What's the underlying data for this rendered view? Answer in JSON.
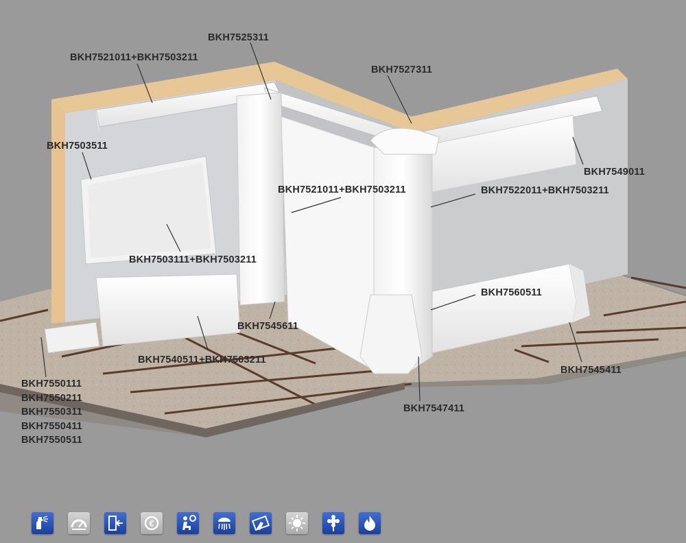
{
  "labels": {
    "l1": "BKH7525311",
    "l2": "BKH7521011+BKH7503211",
    "l3": "BKH7527311",
    "l4": "BKH7503511",
    "l5": "BKH7549011",
    "l6": "BKH7521011+BKH7503211",
    "l7": "BKH7522011+BKH7503211",
    "l8": "BKH7503111+BKH7503211",
    "l9": "BKH7560511",
    "l10": "BKH7545611",
    "l11": "BKH7540511+BKH7503211",
    "l12": "BKH7545411",
    "l13": "BKH7547411",
    "stack": [
      "BKH7550111",
      "BKH7550211",
      "BKH7550311",
      "BKH7550411",
      "BKH7550511"
    ]
  },
  "icons": [
    {
      "name": "spray-icon",
      "style": "blue"
    },
    {
      "name": "gauge-icon",
      "style": "grey"
    },
    {
      "name": "door-exit-icon",
      "style": "blue"
    },
    {
      "name": "euro-icon",
      "style": "grey"
    },
    {
      "name": "person-gear-icon",
      "style": "blue"
    },
    {
      "name": "shower-icon",
      "style": "blue"
    },
    {
      "name": "hand-wipe-icon",
      "style": "blue"
    },
    {
      "name": "sun-icon",
      "style": "grey"
    },
    {
      "name": "gear-flower-icon",
      "style": "blue"
    },
    {
      "name": "flame-icon",
      "style": "blue"
    }
  ],
  "colors": {
    "background": "#9a9a9a",
    "wall": "#e9c99a",
    "wall_panel": "#cfd0d3",
    "trunking": "#f6f6f6",
    "floor_tile": "#bcb0a2",
    "grout": "#5a3a2a",
    "label_text": "#2a2a2a",
    "icon_blue": "#2a52be"
  }
}
